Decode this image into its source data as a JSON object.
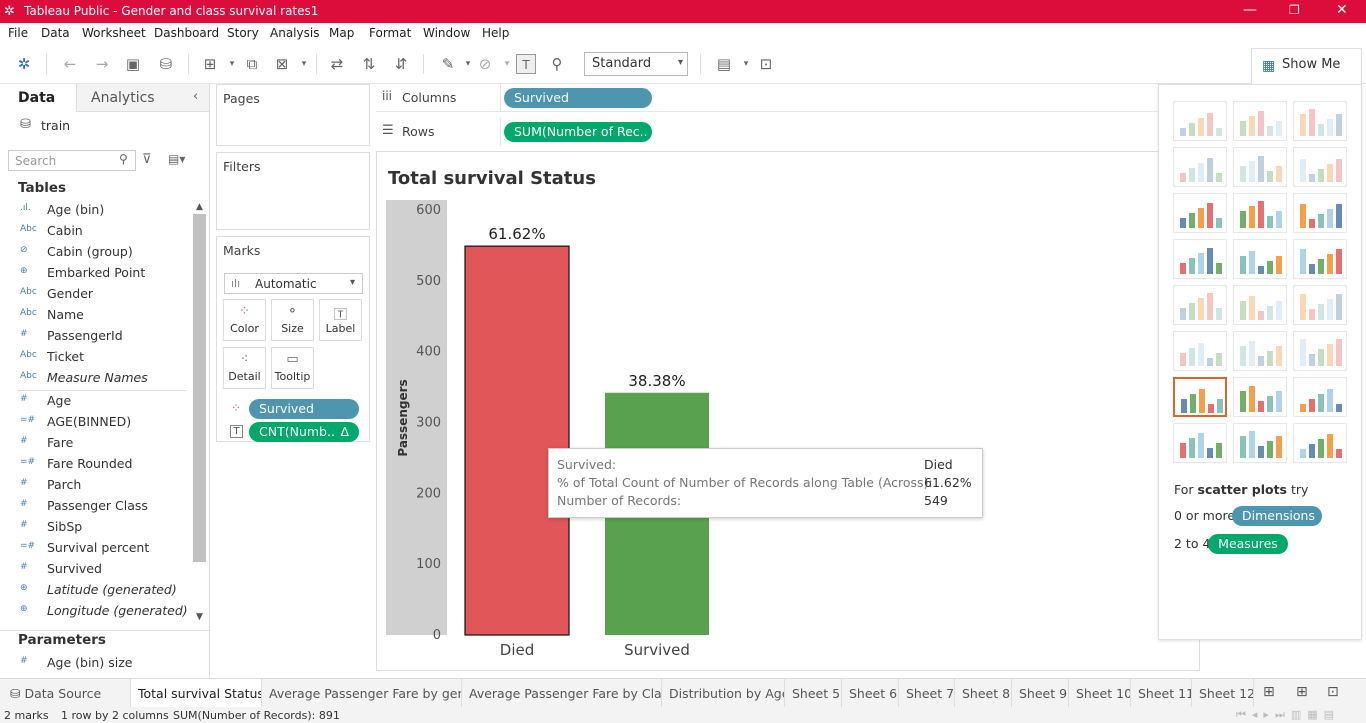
{
  "window": {
    "title": "Tableau Public - Gender and class survival rates1"
  },
  "menu": [
    "File",
    "Data",
    "Worksheet",
    "Dashboard",
    "Story",
    "Analysis",
    "Map",
    "Format",
    "Window",
    "Help"
  ],
  "toolbar": {
    "fit_select": "Standard"
  },
  "show_me": {
    "button_label": "Show Me",
    "hint_prefix": "For ",
    "hint_bold": "scatter plots",
    "hint_suffix": " try",
    "row1_prefix": "0 or more",
    "row1_pill": "Dimensions",
    "row2_prefix": "2 to 4",
    "row2_pill": "Measures"
  },
  "data_pane": {
    "tabs": [
      "Data",
      "Analytics"
    ],
    "datasource": "train",
    "search_placeholder": "Search",
    "tables_heading": "Tables",
    "dimensions": [
      {
        "type": ".ıl.",
        "name": "Age (bin)"
      },
      {
        "type": "Abc",
        "name": "Cabin"
      },
      {
        "type": "⊘",
        "name": "Cabin (group)"
      },
      {
        "type": "⊕",
        "name": "Embarked Point"
      },
      {
        "type": "Abc",
        "name": "Gender"
      },
      {
        "type": "Abc",
        "name": "Name"
      },
      {
        "type": "#",
        "name": "PassengerId"
      },
      {
        "type": "Abc",
        "name": "Ticket"
      },
      {
        "type": "Abc",
        "name": "Measure Names",
        "italic": true
      }
    ],
    "measures": [
      {
        "type": "#",
        "name": "Age"
      },
      {
        "type": "=#",
        "name": "AGE(BINNED)"
      },
      {
        "type": "#",
        "name": "Fare"
      },
      {
        "type": "=#",
        "name": "Fare Rounded"
      },
      {
        "type": "#",
        "name": "Parch"
      },
      {
        "type": "#",
        "name": "Passenger Class"
      },
      {
        "type": "#",
        "name": "SibSp"
      },
      {
        "type": "=#",
        "name": "Survival percent"
      },
      {
        "type": "#",
        "name": "Survived"
      },
      {
        "type": "⊕",
        "name": "Latitude (generated)",
        "italic": true
      },
      {
        "type": "⊕",
        "name": "Longitude (generated)",
        "italic": true
      }
    ],
    "parameters_heading": "Parameters",
    "parameters": [
      {
        "type": "#",
        "name": "Age (bin) size"
      }
    ]
  },
  "shelves": {
    "pages_label": "Pages",
    "filters_label": "Filters",
    "marks_label": "Marks",
    "mark_type": "Automatic",
    "mark_buttons": [
      {
        "icon": "color-icon",
        "label": "Color"
      },
      {
        "icon": "size-icon",
        "label": "Size"
      },
      {
        "icon": "label-icon",
        "label": "Label"
      },
      {
        "icon": "detail-icon",
        "label": "Detail"
      },
      {
        "icon": "tooltip-icon",
        "label": "Tooltip"
      }
    ],
    "mark_pills": [
      {
        "icon": "color-icon",
        "label": "Survived"
      },
      {
        "icon": "label-icon",
        "label": "CNT(Numb..",
        "delta": "Δ"
      }
    ],
    "columns_label": "Columns",
    "columns_pill": "Survived",
    "rows_label": "Rows",
    "rows_pill": "SUM(Number of Rec.."
  },
  "chart_data": {
    "type": "bar",
    "title": "Total survival Status",
    "ylabel": "Passengers",
    "xlabel": "",
    "categories": [
      "Died",
      "Survived"
    ],
    "values": [
      549,
      342
    ],
    "data_labels": [
      "61.62%",
      "38.38%"
    ],
    "colors": [
      "#e15759",
      "#59a14f"
    ],
    "ylim": [
      0,
      600
    ],
    "yticks": [
      0,
      100,
      200,
      300,
      400,
      500,
      600
    ],
    "grid": false
  },
  "tooltip": {
    "rows": [
      {
        "label": "Survived:",
        "value": "Died"
      },
      {
        "label": "% of Total Count of Number of Records along Table (Across):",
        "value": "61.62%"
      },
      {
        "label": "Number of Records:",
        "value": "549"
      }
    ]
  },
  "sheet_tabs": {
    "data_source": "Data Source",
    "tabs": [
      "Total survival Status",
      "Average Passenger Fare by gen...",
      "Average Passenger Fare by Class",
      "Distribution by Age",
      "Sheet 5",
      "Sheet 6",
      "Sheet 7",
      "Sheet 8",
      "Sheet 9",
      "Sheet 10",
      "Sheet 11",
      "Sheet 12"
    ]
  },
  "status": {
    "marks": "2 marks",
    "layout": "1 row by 2 columns",
    "sum": "SUM(Number of Records): 891"
  }
}
